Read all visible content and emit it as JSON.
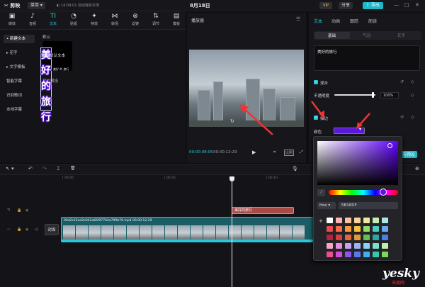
{
  "titlebar": {
    "logo": "✂ 剪映",
    "menu": "菜单 ▾",
    "save_status": "◐ 14:09:01 自动保存本地",
    "title": "8月18日",
    "vip": "VIP",
    "share": "分享",
    "export": "⇪ 导出",
    "win_min": "—",
    "win_max": "□",
    "win_close": "✕"
  },
  "toolbar": {
    "items": [
      {
        "icon": "▣",
        "label": "媒体"
      },
      {
        "icon": "♪",
        "label": "音频"
      },
      {
        "icon": "TI",
        "label": "文本"
      },
      {
        "icon": "◔",
        "label": "贴纸"
      },
      {
        "icon": "✦",
        "label": "特效"
      },
      {
        "icon": "⋈",
        "label": "转场"
      },
      {
        "icon": "⊗",
        "label": "滤镜"
      },
      {
        "icon": "⇅",
        "label": "调节"
      },
      {
        "icon": "▤",
        "label": "模板"
      }
    ]
  },
  "leftnav": [
    "• 新建文本",
    "▸ 花字",
    "▸ 文字模板",
    "智能字幕",
    "识别歌词",
    "本地字幕"
  ],
  "left_content": {
    "default_label": "默认",
    "default_card": "默认文本",
    "my_preset": "我的预设"
  },
  "player": {
    "header": "播放器",
    "menu": "☰",
    "time_current": "00:00:08:05",
    "time_total": "00:00:12:29",
    "overlay_text": "美好的旅行",
    "overlay_small": "美好 的 旅行",
    "play": "▶",
    "fullscreen": "⤢",
    "ratio": "比例",
    "crop": "⌗",
    "rotate": "↻"
  },
  "rightpanel": {
    "tabs": [
      "文本",
      "动画",
      "跟踪",
      "朗读"
    ],
    "subtabs": [
      "基础",
      "气泡",
      "花字"
    ],
    "text_value": "美好的旅行",
    "mix_label": "混合",
    "opacity_label": "不透明度",
    "opacity_value": "100%",
    "stroke_label": "描边",
    "color_label": "颜色",
    "partial_btn": "存预设",
    "reset": "↺",
    "keyframe": "◇",
    "check": "✓"
  },
  "picker": {
    "mode": "Hex ▾",
    "hex": "5B16DF",
    "plus": "+",
    "eyedropper": "⁄"
  },
  "swatch_colors": [
    "#ffffff",
    "#f7b5b3",
    "#f7c3a1",
    "#f6d49c",
    "#f2e7a0",
    "#c8ecb0",
    "#aee6e2",
    "#f04a4a",
    "#f56d4c",
    "#f59c3f",
    "#f5c23e",
    "#97d96a",
    "#47cfc3",
    "#6aa8f4",
    "#b8203b",
    "#dd3a3a",
    "#e3673a",
    "#e09a35",
    "#62bf53",
    "#2aa7a4",
    "#4a7de8",
    "#f8a6c6",
    "#e78de0",
    "#c6a1ef",
    "#9eb2f3",
    "#8dd2f4",
    "#7be0ce",
    "#c3f0a6",
    "#ec4f95",
    "#d24cd6",
    "#8d55e8",
    "#5a78ee",
    "#3fb0ee",
    "#36c9b0",
    "#7ad95b"
  ],
  "timeline": {
    "ticks": [
      "| 00:00",
      "| 00:05",
      "| 00:10"
    ],
    "text_clip": "美好的旅行",
    "clip_name": "09d2c22ad2e942a66f97764a7ff9b76.mp4   00:00:12:29",
    "cover": "封面",
    "tools": [
      "↖ ▾",
      "↶",
      "↷",
      "⌶",
      "🗑"
    ]
  },
  "watermark": {
    "brand": "yesky",
    "sub": "天极网"
  }
}
